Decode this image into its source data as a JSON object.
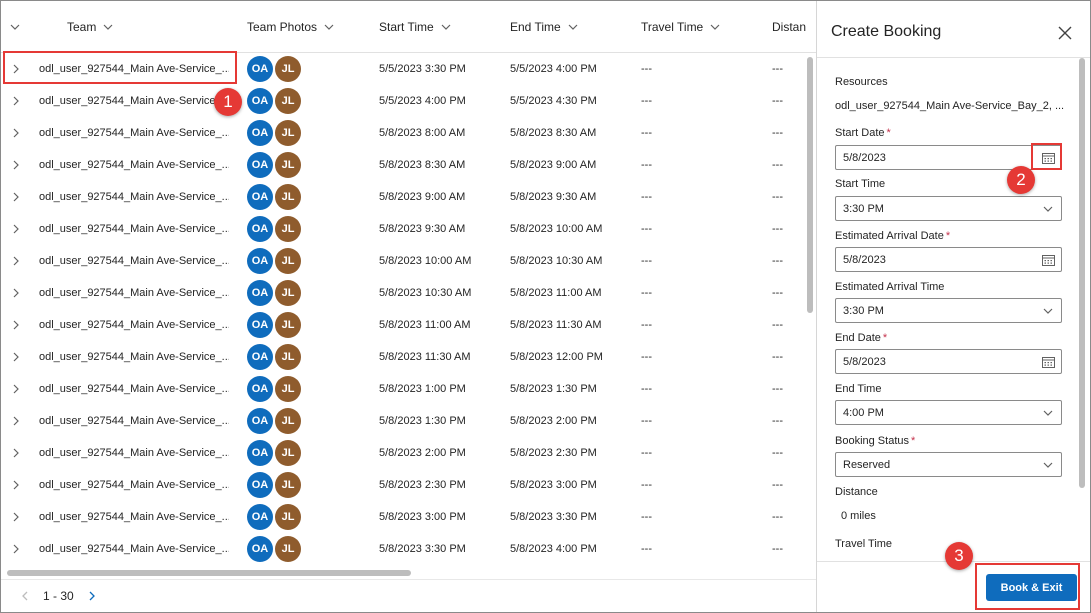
{
  "grid": {
    "columns": [
      {
        "label": "Team"
      },
      {
        "label": "Team Photos"
      },
      {
        "label": "Start Time"
      },
      {
        "label": "End Time"
      },
      {
        "label": "Travel Time"
      },
      {
        "label": "Distan"
      }
    ],
    "rows": [
      {
        "team": "odl_user_927544_Main Ave-Service_...",
        "avatars": [
          "OA",
          "JL"
        ],
        "start": "5/5/2023 3:30 PM",
        "end": "5/5/2023 4:00 PM",
        "travel": "---",
        "distance": "---"
      },
      {
        "team": "odl_user_927544_Main Ave-Service_...",
        "avatars": [
          "OA",
          "JL"
        ],
        "start": "5/5/2023 4:00 PM",
        "end": "5/5/2023 4:30 PM",
        "travel": "---",
        "distance": "---"
      },
      {
        "team": "odl_user_927544_Main Ave-Service_...",
        "avatars": [
          "OA",
          "JL"
        ],
        "start": "5/8/2023 8:00 AM",
        "end": "5/8/2023 8:30 AM",
        "travel": "---",
        "distance": "---"
      },
      {
        "team": "odl_user_927544_Main Ave-Service_...",
        "avatars": [
          "OA",
          "JL"
        ],
        "start": "5/8/2023 8:30 AM",
        "end": "5/8/2023 9:00 AM",
        "travel": "---",
        "distance": "---"
      },
      {
        "team": "odl_user_927544_Main Ave-Service_...",
        "avatars": [
          "OA",
          "JL"
        ],
        "start": "5/8/2023 9:00 AM",
        "end": "5/8/2023 9:30 AM",
        "travel": "---",
        "distance": "---"
      },
      {
        "team": "odl_user_927544_Main Ave-Service_...",
        "avatars": [
          "OA",
          "JL"
        ],
        "start": "5/8/2023 9:30 AM",
        "end": "5/8/2023 10:00 AM",
        "travel": "---",
        "distance": "---"
      },
      {
        "team": "odl_user_927544_Main Ave-Service_...",
        "avatars": [
          "OA",
          "JL"
        ],
        "start": "5/8/2023 10:00 AM",
        "end": "5/8/2023 10:30 AM",
        "travel": "---",
        "distance": "---"
      },
      {
        "team": "odl_user_927544_Main Ave-Service_...",
        "avatars": [
          "OA",
          "JL"
        ],
        "start": "5/8/2023 10:30 AM",
        "end": "5/8/2023 11:00 AM",
        "travel": "---",
        "distance": "---"
      },
      {
        "team": "odl_user_927544_Main Ave-Service_...",
        "avatars": [
          "OA",
          "JL"
        ],
        "start": "5/8/2023 11:00 AM",
        "end": "5/8/2023 11:30 AM",
        "travel": "---",
        "distance": "---"
      },
      {
        "team": "odl_user_927544_Main Ave-Service_...",
        "avatars": [
          "OA",
          "JL"
        ],
        "start": "5/8/2023 11:30 AM",
        "end": "5/8/2023 12:00 PM",
        "travel": "---",
        "distance": "---"
      },
      {
        "team": "odl_user_927544_Main Ave-Service_...",
        "avatars": [
          "OA",
          "JL"
        ],
        "start": "5/8/2023 1:00 PM",
        "end": "5/8/2023 1:30 PM",
        "travel": "---",
        "distance": "---"
      },
      {
        "team": "odl_user_927544_Main Ave-Service_...",
        "avatars": [
          "OA",
          "JL"
        ],
        "start": "5/8/2023 1:30 PM",
        "end": "5/8/2023 2:00 PM",
        "travel": "---",
        "distance": "---"
      },
      {
        "team": "odl_user_927544_Main Ave-Service_...",
        "avatars": [
          "OA",
          "JL"
        ],
        "start": "5/8/2023 2:00 PM",
        "end": "5/8/2023 2:30 PM",
        "travel": "---",
        "distance": "---"
      },
      {
        "team": "odl_user_927544_Main Ave-Service_...",
        "avatars": [
          "OA",
          "JL"
        ],
        "start": "5/8/2023 2:30 PM",
        "end": "5/8/2023 3:00 PM",
        "travel": "---",
        "distance": "---"
      },
      {
        "team": "odl_user_927544_Main Ave-Service_...",
        "avatars": [
          "OA",
          "JL"
        ],
        "start": "5/8/2023 3:00 PM",
        "end": "5/8/2023 3:30 PM",
        "travel": "---",
        "distance": "---"
      },
      {
        "team": "odl_user_927544_Main Ave-Service_...",
        "avatars": [
          "OA",
          "JL"
        ],
        "start": "5/8/2023 3:30 PM",
        "end": "5/8/2023 4:00 PM",
        "travel": "---",
        "distance": "---"
      }
    ],
    "pager": {
      "range": "1 - 30"
    }
  },
  "panel": {
    "title": "Create Booking",
    "resources_label": "Resources",
    "resources_value": "odl_user_927544_Main Ave-Service_Bay_2, ...",
    "start_date_label": "Start Date",
    "start_date_value": "5/8/2023",
    "start_time_label": "Start Time",
    "start_time_value": "3:30 PM",
    "est_arrival_date_label": "Estimated Arrival Date",
    "est_arrival_date_value": "5/8/2023",
    "est_arrival_time_label": "Estimated Arrival Time",
    "est_arrival_time_value": "3:30 PM",
    "end_date_label": "End Date",
    "end_date_value": "5/8/2023",
    "end_time_label": "End Time",
    "end_time_value": "4:00 PM",
    "booking_status_label": "Booking Status",
    "booking_status_value": "Reserved",
    "distance_label": "Distance",
    "distance_value": "0 miles",
    "travel_time_label": "Travel Time",
    "required_mark": "*",
    "book_exit_label": "Book & Exit"
  },
  "annotations": {
    "step1": "1",
    "step2": "2",
    "step3": "3"
  },
  "colors": {
    "accent": "#0f6cbd",
    "annotation": "#e53935",
    "avatar_oa": "#0f6cbd",
    "avatar_jl": "#8f5c2d"
  },
  "icons": {
    "row_expand": "chevron-right-icon",
    "column_sort": "chevron-down-icon",
    "calendar": "calendar-icon",
    "dropdown": "chevron-down-icon",
    "close": "close-icon"
  }
}
